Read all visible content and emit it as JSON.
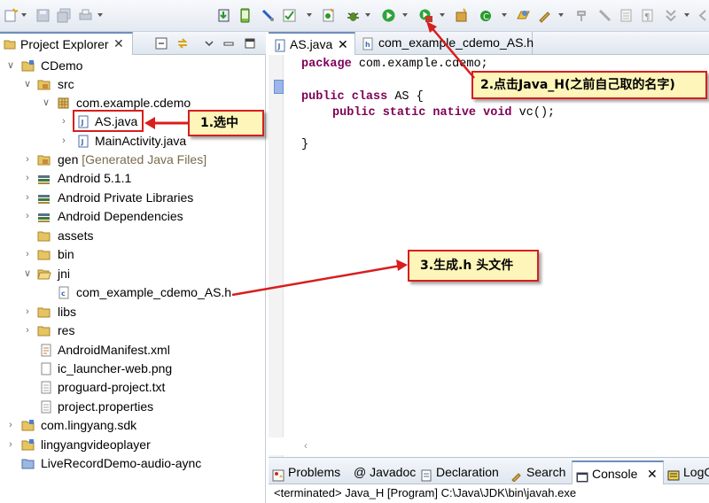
{
  "explorer": {
    "title": "Project Explorer",
    "close": "✕",
    "tree": [
      {
        "label": "CDemo"
      },
      {
        "label": "src"
      },
      {
        "label": "com.example.cdemo"
      },
      {
        "label": "AS.java"
      },
      {
        "label": "MainActivity.java"
      },
      {
        "label": "gen",
        "extra": "[Generated Java Files]"
      },
      {
        "label": "Android 5.1.1"
      },
      {
        "label": "Android Private Libraries"
      },
      {
        "label": "Android Dependencies"
      },
      {
        "label": "assets"
      },
      {
        "label": "bin"
      },
      {
        "label": "jni"
      },
      {
        "label": "com_example_cdemo_AS.h"
      },
      {
        "label": "libs"
      },
      {
        "label": "res"
      },
      {
        "label": "AndroidManifest.xml"
      },
      {
        "label": "ic_launcher-web.png"
      },
      {
        "label": "proguard-project.txt"
      },
      {
        "label": "project.properties"
      },
      {
        "label": "com.lingyang.sdk"
      },
      {
        "label": "lingyangvideoplayer"
      },
      {
        "label": "LiveRecordDemo-audio-aync"
      }
    ]
  },
  "editor": {
    "tabs": [
      {
        "label": "AS.java",
        "close": "✕"
      },
      {
        "label": "com_example_cdemo_AS.h"
      }
    ],
    "code": {
      "l1_kw": "package",
      "l1_rest": " com.example.cdemo;",
      "l2_kw1": "public",
      "l2_kw2": "class",
      "l2_rest": " AS {",
      "l3_kw": "public static native void",
      "l3_rest": " vc();",
      "l4": "}"
    }
  },
  "bottom": {
    "tabs": [
      "Problems",
      "@ Javadoc",
      "Declaration",
      "Search",
      "Console",
      "LogC"
    ],
    "console_close": "✕",
    "console_text": "<terminated> Java_H [Program] C:\\Java\\JDK\\bin\\javah.exe"
  },
  "annotations": {
    "step1": "1.选中",
    "step2": "2.点击Java_H(之前自己取的名字)",
    "step3": "3.生成.h 头文件"
  },
  "colors": {
    "callout_border": "#d81e1e",
    "callout_bg": "#fdf5b9",
    "keyword": "#7f0055"
  }
}
